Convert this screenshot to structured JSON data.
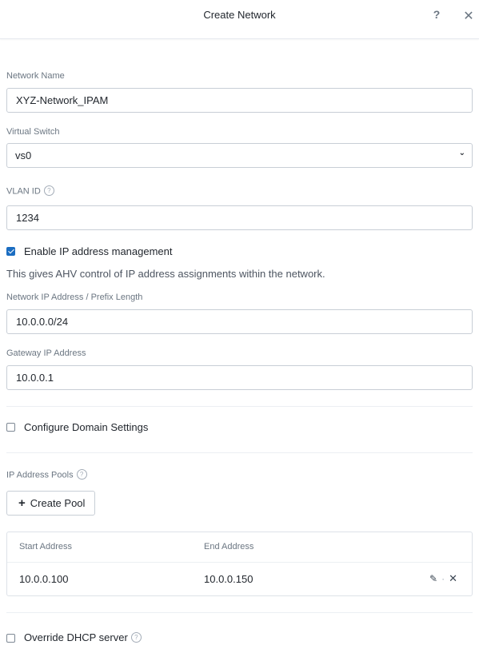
{
  "dialog": {
    "title": "Create Network",
    "help_icon": "?",
    "close_icon": "✕"
  },
  "network_name": {
    "label": "Network Name",
    "value": "XYZ-Network_IPAM"
  },
  "virtual_switch": {
    "label": "Virtual Switch",
    "selected": "vs0",
    "chevron": "⌄"
  },
  "vlan_id": {
    "label": "VLAN ID",
    "value": "1234"
  },
  "ipam": {
    "checkbox_label": "Enable IP address management",
    "checked": true,
    "description": "This gives AHV control of IP address assignments within the network."
  },
  "network_ip": {
    "label": "Network IP Address / Prefix Length",
    "value": "10.0.0.0/24"
  },
  "gateway_ip": {
    "label": "Gateway IP Address",
    "value": "10.0.0.1"
  },
  "domain_settings": {
    "checkbox_label": "Configure Domain Settings",
    "checked": false
  },
  "ip_pools": {
    "label": "IP Address Pools",
    "create_button_label": "Create Pool",
    "columns": [
      "Start Address",
      "End Address"
    ],
    "rows": [
      {
        "start": "10.0.0.100",
        "end": "10.0.0.150"
      }
    ]
  },
  "dhcp_override": {
    "checkbox_label": "Override DHCP server",
    "checked": false
  },
  "colors": {
    "accent": "#1b6dc1",
    "border": "#c8ced6",
    "label": "#6b7682"
  },
  "icons": {
    "help": "help-icon",
    "close": "close-icon",
    "info": "question-circle-icon",
    "edit": "pencil-icon",
    "delete": "close-icon",
    "add": "plus-icon"
  }
}
